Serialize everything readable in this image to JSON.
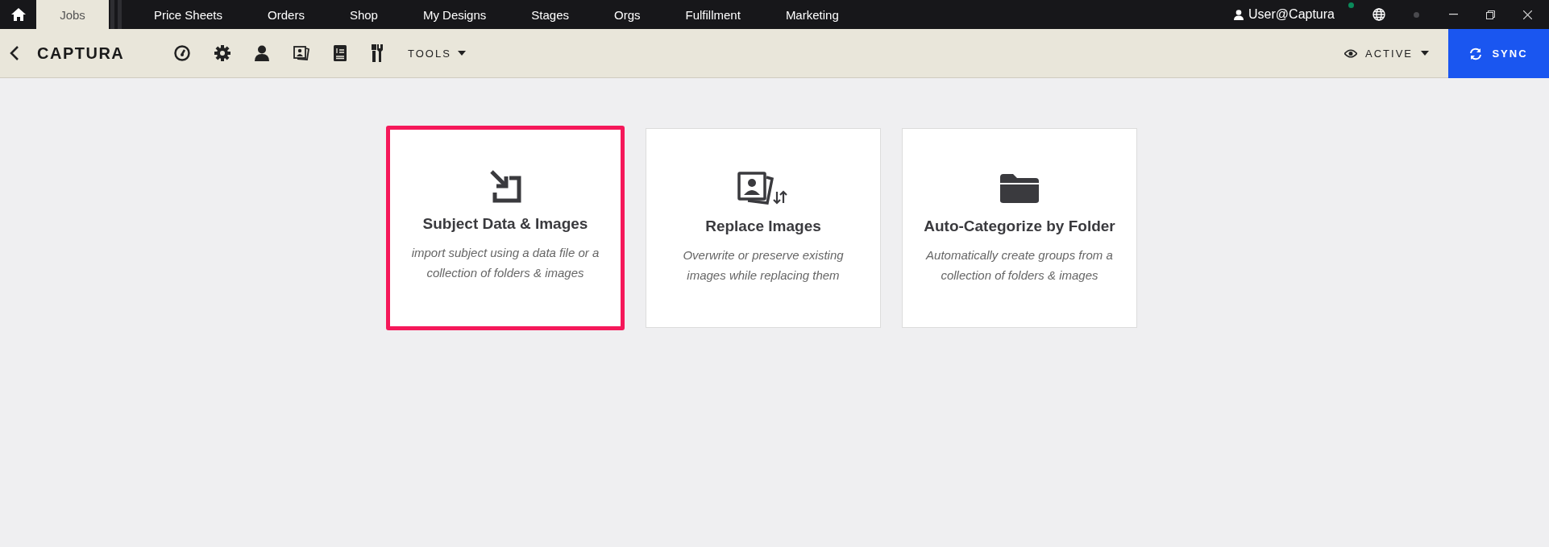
{
  "top_tabs": [
    {
      "label": "Jobs",
      "selected": true
    },
    {
      "label": "Price Sheets",
      "selected": false
    },
    {
      "label": "Orders",
      "selected": false
    },
    {
      "label": "Shop",
      "selected": false
    },
    {
      "label": "My Designs",
      "selected": false
    },
    {
      "label": "Stages",
      "selected": false
    },
    {
      "label": "Orgs",
      "selected": false
    },
    {
      "label": "Fulfillment",
      "selected": false
    },
    {
      "label": "Marketing",
      "selected": false
    }
  ],
  "user": "User@Captura",
  "toolbar": {
    "title": "CAPTURA",
    "tools_label": "TOOLS",
    "filter_label": "ACTIVE",
    "sync_label": "SYNC"
  },
  "cards": [
    {
      "kind": "import",
      "title": "Subject Data & Images",
      "description": "import subject using a data file or a collection of folders & images",
      "selected": true
    },
    {
      "kind": "replace",
      "title": "Replace Images",
      "description": "Overwrite or preserve existing images while replacing them",
      "selected": false
    },
    {
      "kind": "folder",
      "title": "Auto-Categorize by Folder",
      "description": "Automatically create groups from a collection of folders & images",
      "selected": false
    }
  ]
}
